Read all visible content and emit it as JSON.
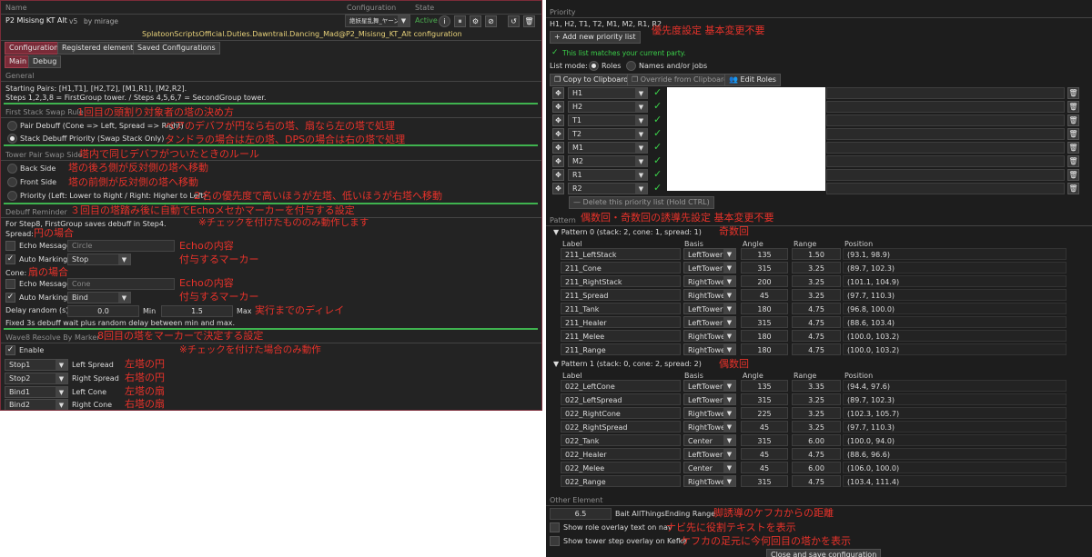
{
  "colors": {
    "accent": "#7a2b38",
    "annotation": "#e8322a",
    "divider": "#3fb34f",
    "active_state": "#4caf50",
    "check": "#3bd14a"
  },
  "header": {
    "col_name": "Name",
    "col_configuration": "Configuration",
    "col_state": "State",
    "script_name": "P2 Misisng KT Alt",
    "version": "v5",
    "author": "by mirage",
    "config_value": "絶妖星乱舞_ヤーン",
    "state": "Active",
    "path": "SplatoonScriptsOfficial.Duties.Dawntrail.Dancing_Mad@P2_Misisng_KT_Alt configuration"
  },
  "tabs": [
    "Configuration",
    "Registered elements",
    "Saved Configurations"
  ],
  "subtabs": [
    "Main",
    "Debug"
  ],
  "general": {
    "title": "General",
    "line1": "Starting Pairs: [H1,T1], [H2,T2], [M1,R1], [M2,R2].",
    "line2": "Steps 1,2,3,8 = FirstGroup tower. / Steps 4,5,6,7 = SecondGroup tower."
  },
  "first_stack": {
    "title": "First Stack Swap Rule",
    "opt1": "Pair Debuff (Cone => Left, Spread => Right)",
    "opt2": "Stack Debuff Priority (Swap Stack Only)"
  },
  "tower_pair": {
    "title": "Tower Pair Swap Side",
    "opt1": "Back Side",
    "opt2": "Front Side",
    "opt3": "Priority (Left: Lower to Right / Right: Higher to Left)"
  },
  "debuff": {
    "title": "Debuff Reminder",
    "info": "For Step8, FirstGroup saves debuff in Step4.",
    "spread_label": "Spread:",
    "cone_label": "Cone:",
    "echo_label": "Echo Message",
    "spread_echo": "Circle",
    "cone_echo": "Cone",
    "auto_label": "Auto Marking",
    "spread_mark": "Stop",
    "cone_mark": "Bind",
    "delay_label": "Delay random (s)",
    "delay_min": "0.0",
    "min_label": "Min",
    "delay_max": "1.5",
    "max_label": "Max",
    "fixed_note": "Fixed 3s debuff wait plus random delay between min and max."
  },
  "wave8": {
    "title": "Wave8 Resolve By Marker",
    "enable": "Enable",
    "rows": [
      {
        "marker": "Stop1",
        "label": "Left Spread"
      },
      {
        "marker": "Stop2",
        "label": "Right Spread"
      },
      {
        "marker": "Bind1",
        "label": "Left Cone"
      },
      {
        "marker": "Bind2",
        "label": "Right Cone"
      }
    ]
  },
  "ann_left": {
    "a1": "1回目の頭割り対象者の塔の決め方",
    "a2": "ペアのデバフが円なら右の塔、扇なら左の塔で処理",
    "a3": "タンドラの場合は左の塔、DPSの場合は右の塔で処理",
    "a4": "塔内で同じデバフがついたときのルール",
    "a5": "塔の後ろ側が反対側の塔へ移動",
    "a6": "塔の前側が反対側の塔へ移動",
    "a7": "２名の優先度で高いほうが左塔、低いほうが右塔へ移動",
    "a8": "３回目の塔踏み後に自動でEchoメセかマーカーを付与する設定",
    "a9": "※チェックを付けたもののみ動作します",
    "a10": "円の場合",
    "a11": "Echoの内容",
    "a12": "付与するマーカー",
    "a13": "扇の場合",
    "a14": "Echoの内容",
    "a15": "付与するマーカー",
    "a16": "実行までのディレイ",
    "a17": "8回目の塔をマーカーで決定する設定",
    "a18": "※チェックを付けた場合のみ動作",
    "a19": "左塔の円",
    "a20": "右塔の円",
    "a21": "左塔の扇",
    "a22": "右塔の扇"
  },
  "priority": {
    "title": "Priority",
    "list": "H1, H2, T1, T2, M1, M2, R1, R2",
    "add_btn": "Add new priority list",
    "match": "This list matches your current party.",
    "mode_label": "List mode:",
    "mode_roles": "Roles",
    "mode_names": "Names and/or jobs",
    "copy_btn": "Copy to Clipboard",
    "override_btn": "Override from Clipboard",
    "edit_btn": "Edit Roles",
    "roles": [
      "H1",
      "H2",
      "T1",
      "T2",
      "M1",
      "M2",
      "R1",
      "R2"
    ],
    "delete_btn": "Delete this priority list (Hold CTRL)"
  },
  "pattern": {
    "title": "Pattern",
    "headers": [
      "Label",
      "Basis",
      "Angle",
      "Range",
      "Position"
    ],
    "p0": {
      "title": "Pattern 0 (stack: 2, cone: 1, spread: 1)",
      "rows": [
        [
          "211_LeftStack",
          "LeftTower",
          "135",
          "1.50",
          "(93.1, 98.9)"
        ],
        [
          "211_Cone",
          "LeftTower",
          "315",
          "3.25",
          "(89.7, 102.3)"
        ],
        [
          "211_RightStack",
          "RightTower",
          "200",
          "3.25",
          "(101.1, 104.9)"
        ],
        [
          "211_Spread",
          "RightTower",
          "45",
          "3.25",
          "(97.7, 110.3)"
        ],
        [
          "211_Tank",
          "LeftTower",
          "180",
          "4.75",
          "(96.8, 100.0)"
        ],
        [
          "211_Healer",
          "LeftTower",
          "315",
          "4.75",
          "(88.6, 103.4)"
        ],
        [
          "211_Melee",
          "RightTower",
          "180",
          "4.75",
          "(100.0, 103.2)"
        ],
        [
          "211_Range",
          "RightTower",
          "180",
          "4.75",
          "(100.0, 103.2)"
        ]
      ]
    },
    "p1": {
      "title": "Pattern 1 (stack: 0, cone: 2, spread: 2)",
      "rows": [
        [
          "022_LeftCone",
          "LeftTower",
          "135",
          "3.35",
          "(94.4, 97.6)"
        ],
        [
          "022_LeftSpread",
          "LeftTower",
          "315",
          "3.25",
          "(89.7, 102.3)"
        ],
        [
          "022_RightCone",
          "RightTower",
          "225",
          "3.25",
          "(102.3, 105.7)"
        ],
        [
          "022_RightSpread",
          "RightTower",
          "45",
          "3.25",
          "(97.7, 110.3)"
        ],
        [
          "022_Tank",
          "Center",
          "315",
          "6.00",
          "(100.0, 94.0)"
        ],
        [
          "022_Healer",
          "LeftTower",
          "45",
          "4.75",
          "(88.6, 96.6)"
        ],
        [
          "022_Melee",
          "Center",
          "45",
          "6.00",
          "(106.0, 100.0)"
        ],
        [
          "022_Range",
          "RightTower",
          "315",
          "4.75",
          "(103.4, 111.4)"
        ]
      ]
    }
  },
  "other": {
    "title": "Other Element",
    "bait_value": "6.5",
    "bait_label": "Bait AllThingsEnding Range",
    "overlay_label": "Show role overlay text on nav",
    "tower_label": "Show tower step overlay on Kefka",
    "close_btn": "Close and save configuration"
  },
  "ann_right": {
    "b1": "優先度設定 基本変更不要",
    "b2": "偶数回・奇数回の誘導先設定 基本変更不要",
    "b3": "奇数回",
    "b4": "偶数回",
    "b5": "脚誘導のケフカからの距離",
    "b6": "ナビ先に役割テキストを表示",
    "b7": "ケフカの足元に今何回目の塔かを表示"
  }
}
